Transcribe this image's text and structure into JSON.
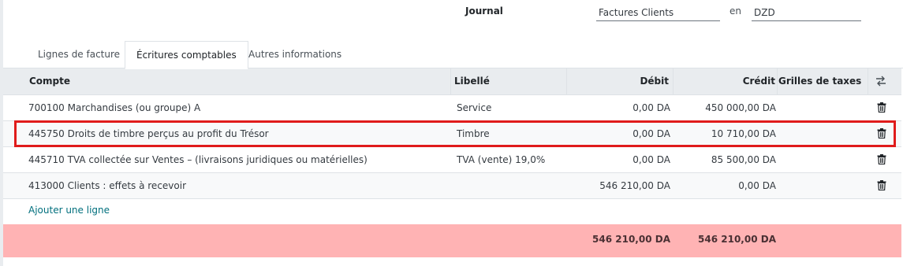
{
  "header": {
    "journal_label": "Journal",
    "journal_value": "Factures Clients",
    "en_label": "en",
    "currency_value": "DZD"
  },
  "tabs": [
    {
      "label": "Lignes de facture",
      "active": false
    },
    {
      "label": "Écritures comptables",
      "active": true
    },
    {
      "label": "Autres informations",
      "active": false
    }
  ],
  "table": {
    "columns": {
      "compte": "Compte",
      "libelle": "Libellé",
      "debit": "Débit",
      "credit": "Crédit",
      "grilles": "Grilles de taxes"
    },
    "rows": [
      {
        "compte": "700100 Marchandises (ou groupe) A",
        "libelle": "Service",
        "debit": "0,00 DA",
        "credit": "450 000,00 DA"
      },
      {
        "compte": "445750 Droits de timbre perçus au profit du Trésor",
        "libelle": "Timbre",
        "debit": "0,00 DA",
        "credit": "10 710,00 DA"
      },
      {
        "compte": "445710 TVA collectée sur Ventes – (livraisons juridiques ou matérielles)",
        "libelle": "TVA (vente) 19,0%",
        "debit": "0,00 DA",
        "credit": "85 500,00 DA"
      },
      {
        "compte": "413000 Clients : effets à recevoir",
        "libelle": "",
        "debit": "546 210,00 DA",
        "credit": "0,00 DA"
      }
    ],
    "add_line": "Ajouter une ligne",
    "totals": {
      "debit": "546 210,00 DA",
      "credit": "546 210,00 DA"
    }
  },
  "colors": {
    "highlight_border": "#e01b1b",
    "totals_background": "#ffb3b4",
    "link": "#016f7d"
  },
  "icons": [
    "trash-icon",
    "column-settings-icon"
  ]
}
